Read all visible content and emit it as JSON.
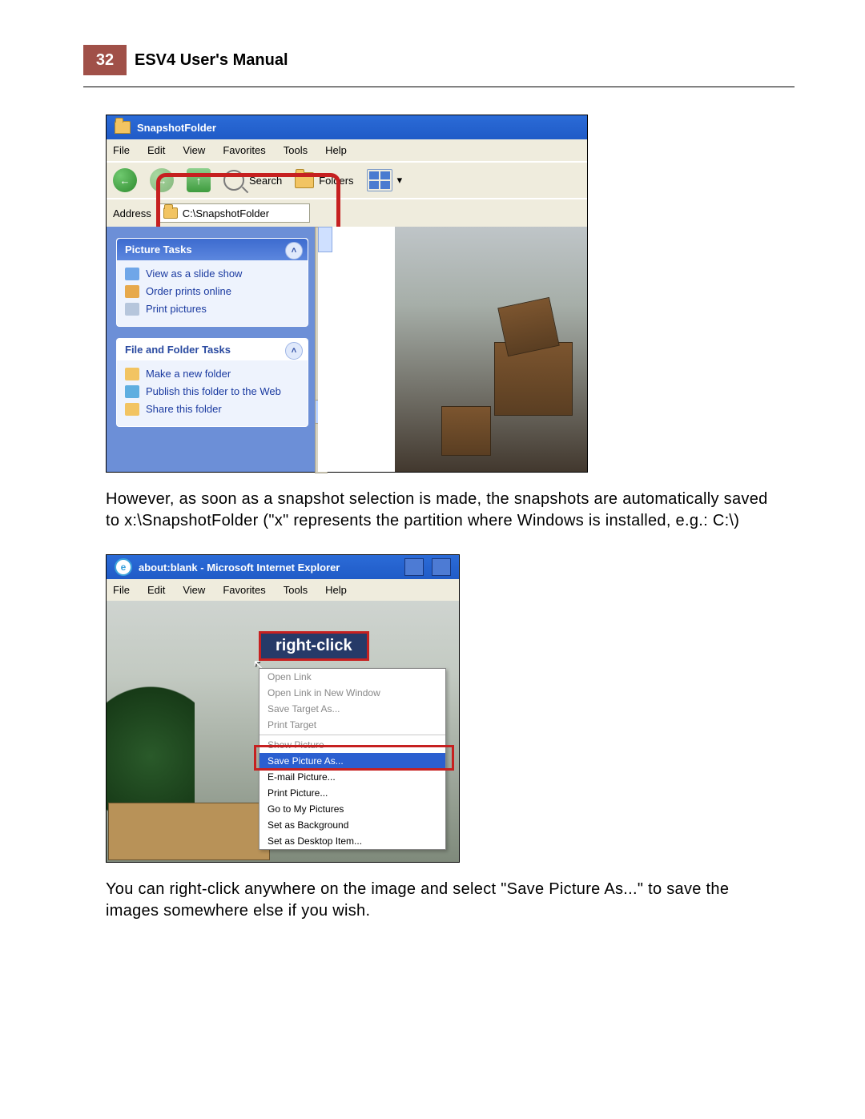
{
  "header": {
    "page_num": "32",
    "title": "ESV4 User's Manual"
  },
  "paragraph1": "However, as soon as a snapshot selection is made, the snapshots are automatically saved to x:\\SnapshotFolder (\"x\" represents the partition where Windows is installed, e.g.: C:\\)",
  "paragraph2": "You can right-click anywhere on the image and select \"Save Picture As...\" to save the images somewhere else if you wish.",
  "fig1": {
    "window_title": "SnapshotFolder",
    "menu": [
      "File",
      "Edit",
      "View",
      "Favorites",
      "Tools",
      "Help"
    ],
    "toolbar": {
      "search": "Search",
      "folders": "Folders"
    },
    "address_label": "Address",
    "address_value": "C:\\SnapshotFolder",
    "picture_tasks": {
      "title": "Picture Tasks",
      "items": [
        "View as a slide show",
        "Order prints online",
        "Print pictures"
      ]
    },
    "folder_tasks": {
      "title": "File and Folder Tasks",
      "items": [
        "Make a new folder",
        "Publish this folder to the Web",
        "Share this folder"
      ]
    }
  },
  "fig2": {
    "window_title": "about:blank - Microsoft Internet Explorer",
    "menu": [
      "File",
      "Edit",
      "View",
      "Favorites",
      "Tools",
      "Help"
    ],
    "right_click_label": "right-click",
    "context_menu": [
      {
        "label": "Open Link",
        "enabled": false
      },
      {
        "label": "Open Link in New Window",
        "enabled": false
      },
      {
        "label": "Save Target As...",
        "enabled": false
      },
      {
        "label": "Print Target",
        "enabled": false
      },
      {
        "label": "Show Picture",
        "enabled": false,
        "sep_before": true
      },
      {
        "label": "Save Picture As...",
        "enabled": true,
        "selected": true
      },
      {
        "label": "E-mail Picture...",
        "enabled": true
      },
      {
        "label": "Print Picture...",
        "enabled": true
      },
      {
        "label": "Go to My Pictures",
        "enabled": true
      },
      {
        "label": "Set as Background",
        "enabled": true
      },
      {
        "label": "Set as Desktop Item...",
        "enabled": true
      }
    ]
  }
}
